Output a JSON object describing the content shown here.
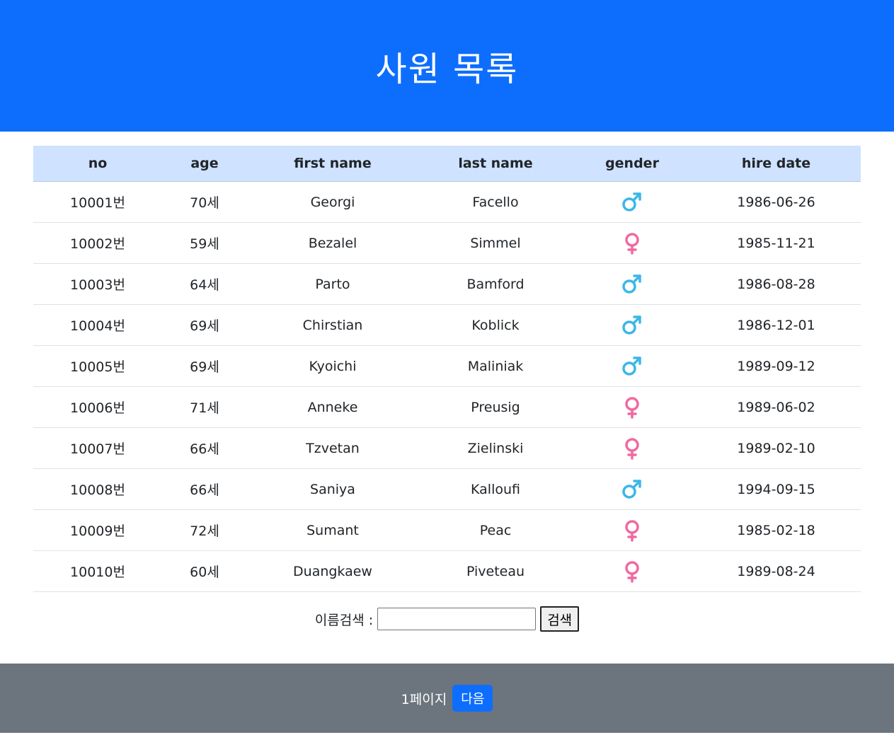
{
  "header": {
    "title": "사원 목록"
  },
  "table": {
    "columns": [
      "no",
      "age",
      "first name",
      "last name",
      "gender",
      "hire date"
    ],
    "rows": [
      {
        "no": "10001번",
        "age": "70세",
        "first_name": "Georgi",
        "last_name": "Facello",
        "gender": "male",
        "hire_date": "1986-06-26"
      },
      {
        "no": "10002번",
        "age": "59세",
        "first_name": "Bezalel",
        "last_name": "Simmel",
        "gender": "female",
        "hire_date": "1985-11-21"
      },
      {
        "no": "10003번",
        "age": "64세",
        "first_name": "Parto",
        "last_name": "Bamford",
        "gender": "male",
        "hire_date": "1986-08-28"
      },
      {
        "no": "10004번",
        "age": "69세",
        "first_name": "Chirstian",
        "last_name": "Koblick",
        "gender": "male",
        "hire_date": "1986-12-01"
      },
      {
        "no": "10005번",
        "age": "69세",
        "first_name": "Kyoichi",
        "last_name": "Maliniak",
        "gender": "male",
        "hire_date": "1989-09-12"
      },
      {
        "no": "10006번",
        "age": "71세",
        "first_name": "Anneke",
        "last_name": "Preusig",
        "gender": "female",
        "hire_date": "1989-06-02"
      },
      {
        "no": "10007번",
        "age": "66세",
        "first_name": "Tzvetan",
        "last_name": "Zielinski",
        "gender": "female",
        "hire_date": "1989-02-10"
      },
      {
        "no": "10008번",
        "age": "66세",
        "first_name": "Saniya",
        "last_name": "Kalloufi",
        "gender": "male",
        "hire_date": "1994-09-15"
      },
      {
        "no": "10009번",
        "age": "72세",
        "first_name": "Sumant",
        "last_name": "Peac",
        "gender": "female",
        "hire_date": "1985-02-18"
      },
      {
        "no": "10010번",
        "age": "60세",
        "first_name": "Duangkaew",
        "last_name": "Piveteau",
        "gender": "female",
        "hire_date": "1989-08-24"
      }
    ]
  },
  "icons": {
    "male": "male-icon",
    "female": "female-icon"
  },
  "colors": {
    "header_bg": "#0d6efd",
    "table_head_bg": "#cfe2ff",
    "footer_bg": "#6c757d",
    "male": "#3bb7e8",
    "female": "#ef6aa0"
  },
  "search": {
    "label": "이름검색 :",
    "value": "",
    "button_label": "검색"
  },
  "footer": {
    "page_label": "1페이지",
    "next_label": "다음"
  }
}
